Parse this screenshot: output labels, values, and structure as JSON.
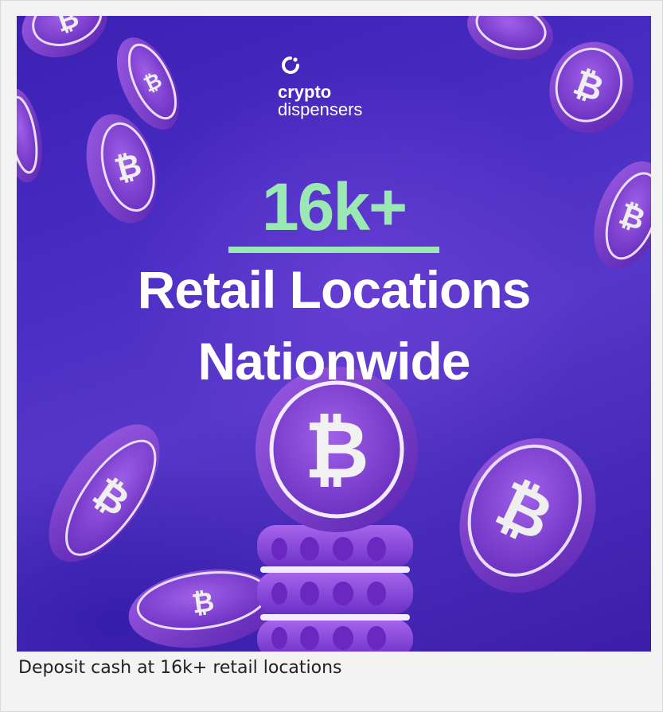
{
  "promo": {
    "logo": {
      "icon": "crypto-dispensers-logo-icon",
      "word1": "crypto",
      "word2": "dispensers"
    },
    "stat": "16k+",
    "headline_line1": "Retail Locations",
    "headline_line2": "Nationwide",
    "colors": {
      "background": "#4a2ec4",
      "accent": "#9ae9b2",
      "coin": "#8a4fd6",
      "coin_symbol": "#f2f2f2"
    }
  },
  "caption": "Deposit cash at 16k+ retail locations"
}
